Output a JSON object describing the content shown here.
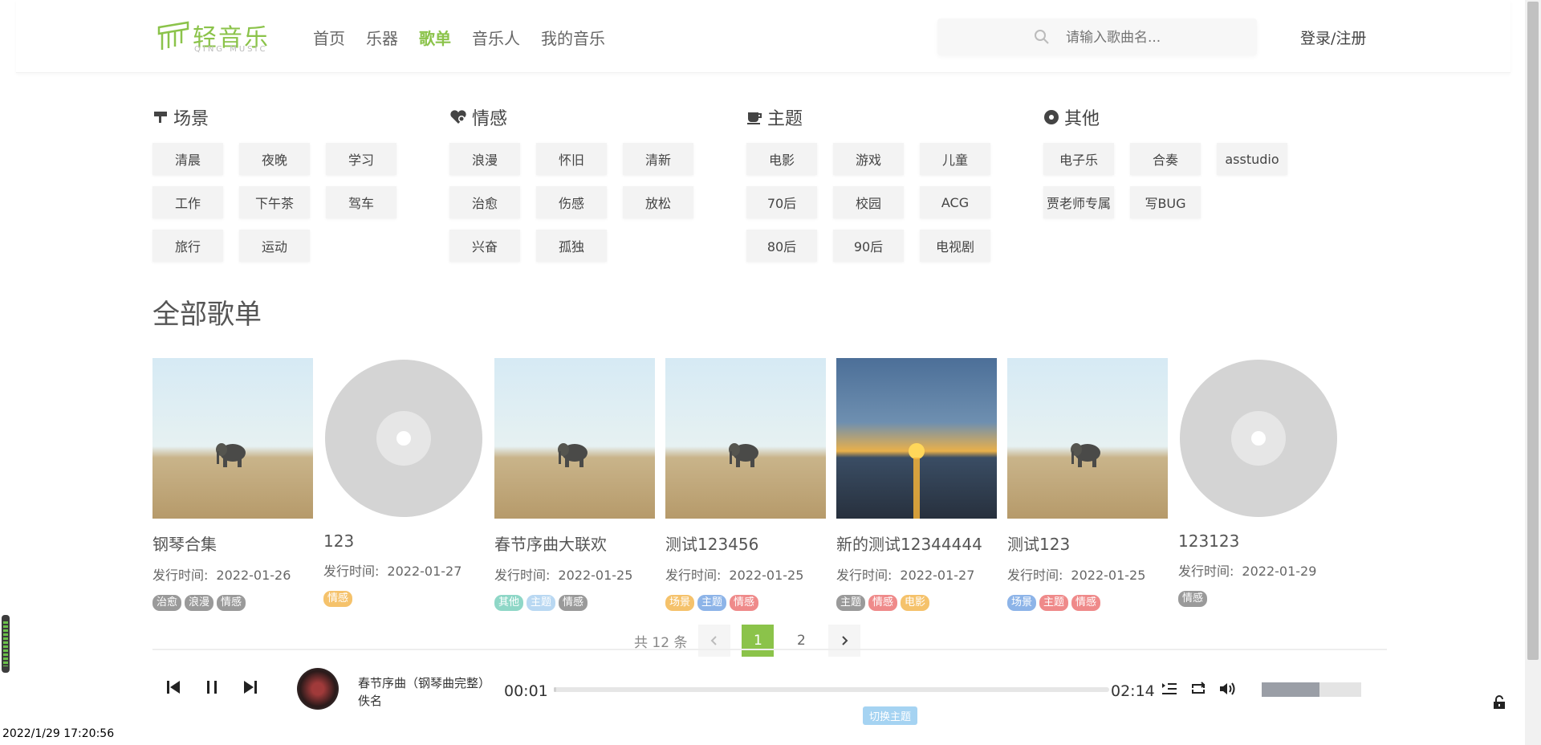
{
  "logo": {
    "cn": "轻音乐",
    "en": "QING MUSIC"
  },
  "nav": [
    {
      "label": "首页",
      "active": false
    },
    {
      "label": "乐器",
      "active": false
    },
    {
      "label": "歌单",
      "active": true
    },
    {
      "label": "音乐人",
      "active": false
    },
    {
      "label": "我的音乐",
      "active": false
    }
  ],
  "search": {
    "placeholder": "请输入歌曲名...",
    "icon": "search-icon"
  },
  "login": "登录/注册",
  "categories": [
    {
      "title": "场景",
      "icon": "lamp-icon",
      "tags": [
        "清晨",
        "夜晚",
        "学习",
        "工作",
        "下午茶",
        "驾车",
        "旅行",
        "运动"
      ]
    },
    {
      "title": "情感",
      "icon": "heart-icon",
      "tags": [
        "浪漫",
        "怀旧",
        "清新",
        "治愈",
        "伤感",
        "放松",
        "兴奋",
        "孤独"
      ]
    },
    {
      "title": "主题",
      "icon": "coffee-icon",
      "tags": [
        "电影",
        "游戏",
        "儿童",
        "70后",
        "校园",
        "ACG",
        "80后",
        "90后",
        "电视剧"
      ]
    },
    {
      "title": "其他",
      "icon": "disc-icon",
      "tags": [
        "电子乐",
        "合奏",
        "asstudio",
        "贾老师专属",
        "写BUG"
      ]
    }
  ],
  "section_title": "全部歌单",
  "date_label": "发行时间:",
  "playlists": [
    {
      "title": "钢琴合集",
      "date": "2022-01-26",
      "cover": "elephant",
      "tags": [
        {
          "t": "治愈",
          "c": "#9a9a9a"
        },
        {
          "t": "浪漫",
          "c": "#9a9a9a"
        },
        {
          "t": "情感",
          "c": "#9a9a9a"
        }
      ]
    },
    {
      "title": "123",
      "date": "2022-01-27",
      "cover": "disc",
      "tags": [
        {
          "t": "情感",
          "c": "#f5c26b"
        }
      ]
    },
    {
      "title": "春节序曲大联欢",
      "date": "2022-01-25",
      "cover": "elephant",
      "tags": [
        {
          "t": "其他",
          "c": "#8fd7c7"
        },
        {
          "t": "主题",
          "c": "#b9d8f2"
        },
        {
          "t": "情感",
          "c": "#9a9a9a"
        }
      ]
    },
    {
      "title": "测试123456",
      "date": "2022-01-25",
      "cover": "elephant",
      "tags": [
        {
          "t": "场景",
          "c": "#f5c26b"
        },
        {
          "t": "主题",
          "c": "#8db4e8"
        },
        {
          "t": "情感",
          "c": "#ef8a8a"
        }
      ]
    },
    {
      "title": "新的测试12344444",
      "date": "2022-01-27",
      "cover": "sunset",
      "tags": [
        {
          "t": "主题",
          "c": "#9a9a9a"
        },
        {
          "t": "情感",
          "c": "#ef8a8a"
        },
        {
          "t": "电影",
          "c": "#f5c26b"
        }
      ]
    },
    {
      "title": "测试123",
      "date": "2022-01-25",
      "cover": "elephant",
      "tags": [
        {
          "t": "场景",
          "c": "#8db4e8"
        },
        {
          "t": "主题",
          "c": "#ef8a8a"
        },
        {
          "t": "情感",
          "c": "#ef8a8a"
        }
      ]
    },
    {
      "title": "123123",
      "date": "2022-01-29",
      "cover": "disc",
      "tags": [
        {
          "t": "情感",
          "c": "#9a9a9a"
        }
      ]
    }
  ],
  "pager": {
    "total": "共 12 条",
    "pages": [
      "1",
      "2"
    ],
    "current": "1"
  },
  "player": {
    "song": "春节序曲（钢琴曲完整）",
    "artist": "佚名",
    "current_time": "00:01",
    "total_time": "02:14",
    "progress": 0.005,
    "volume": 0.58
  },
  "theme_button": "切换主题",
  "clock": "2022/1/29 17:20:56",
  "colors": {
    "accent": "#8bc34a"
  }
}
